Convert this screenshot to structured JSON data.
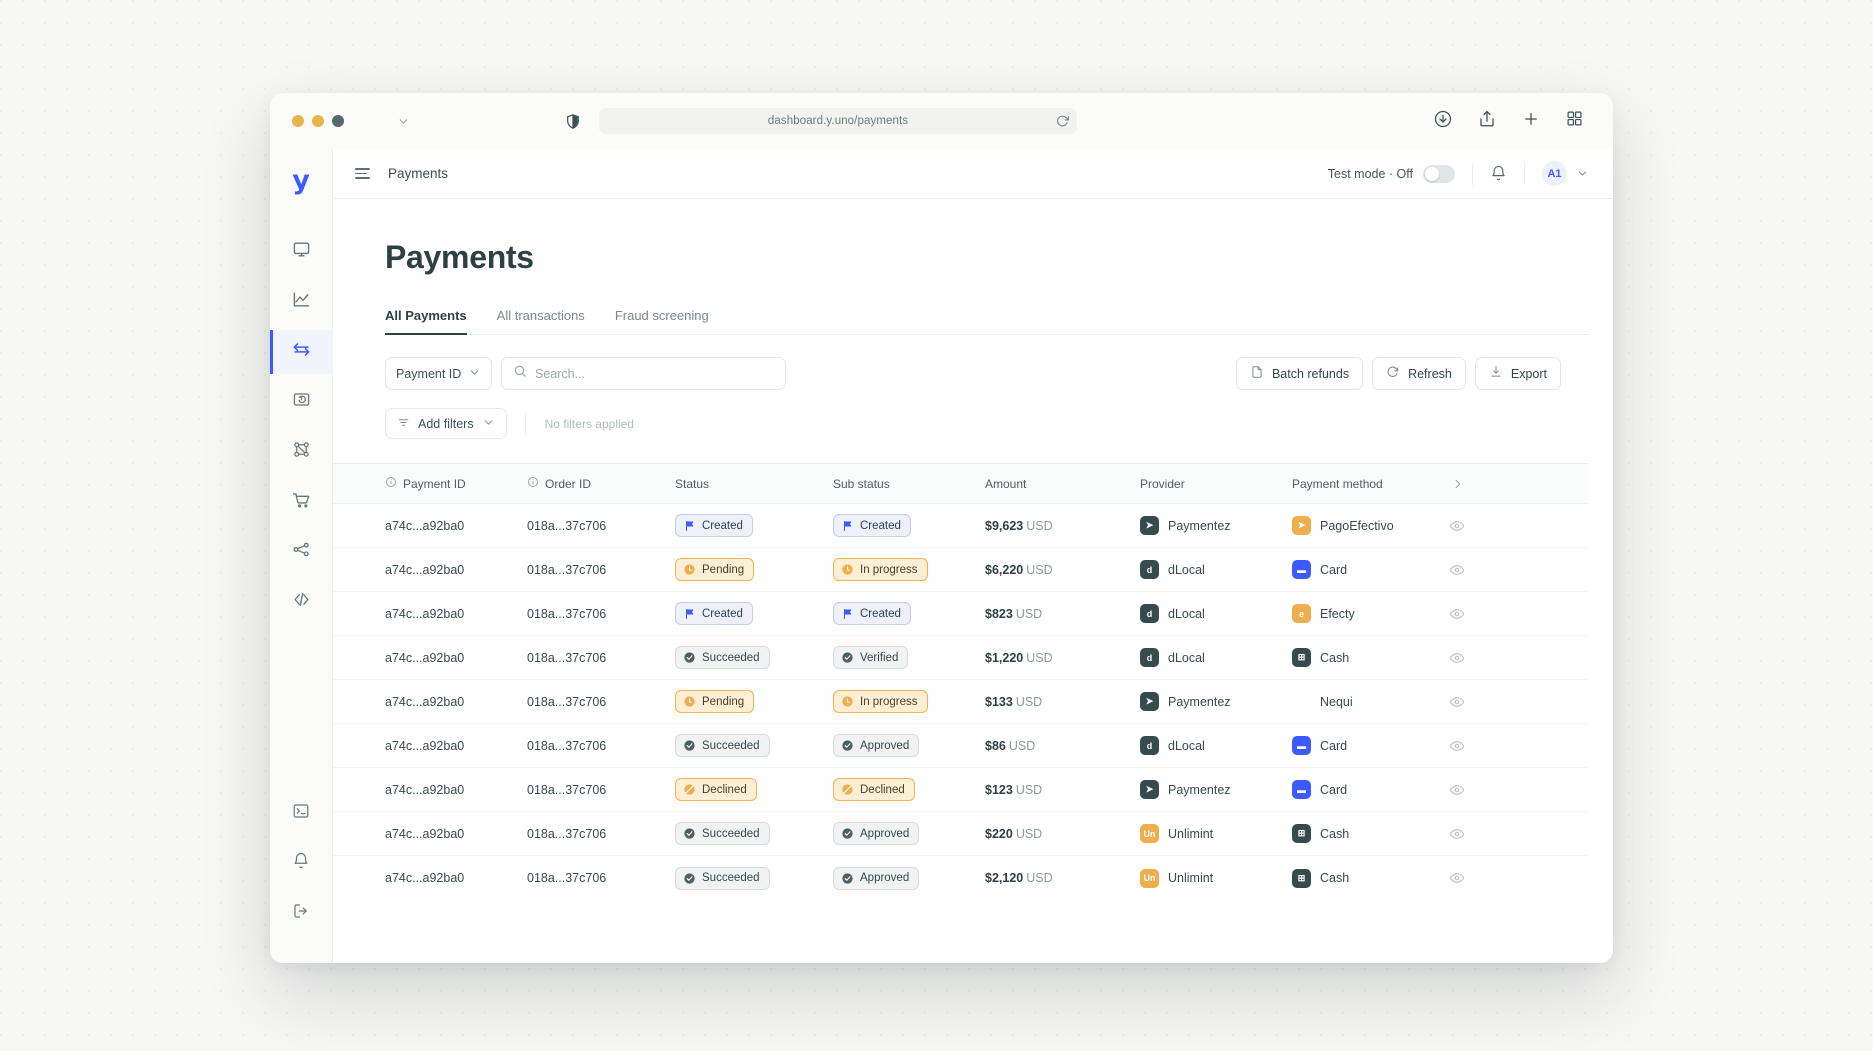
{
  "browser": {
    "url": "dashboard.y.uno/payments",
    "icons": [
      "shield-icon",
      "reload-icon",
      "download-icon",
      "share-icon",
      "new-tab-icon",
      "tab-overview-icon"
    ]
  },
  "rail": {
    "logo": "y",
    "items": [
      {
        "name": "dashboard",
        "icon": "monitor-icon",
        "active": false
      },
      {
        "name": "analytics",
        "icon": "chart-line-icon",
        "active": false
      },
      {
        "name": "payments",
        "icon": "transfer-arrows-icon",
        "active": true
      },
      {
        "name": "refunds",
        "icon": "refund-icon",
        "active": false
      },
      {
        "name": "routing",
        "icon": "nodes-icon",
        "active": false
      },
      {
        "name": "checkout",
        "icon": "cart-icon",
        "active": false
      },
      {
        "name": "connections",
        "icon": "share-nodes-icon",
        "active": false
      },
      {
        "name": "developers",
        "icon": "code-brackets-icon",
        "active": false
      }
    ],
    "bottom": [
      {
        "name": "console",
        "icon": "terminal-icon"
      },
      {
        "name": "notifications",
        "icon": "bell-icon"
      },
      {
        "name": "logout",
        "icon": "logout-icon"
      }
    ]
  },
  "topbar": {
    "breadcrumb": "Payments",
    "test_mode_label": "Test mode · Off",
    "test_mode_on": false,
    "avatar_initials": "A1"
  },
  "page": {
    "title": "Payments",
    "tabs": [
      {
        "label": "All Payments",
        "active": true
      },
      {
        "label": "All transactions",
        "active": false
      },
      {
        "label": "Fraud screening",
        "active": false
      }
    ]
  },
  "filters": {
    "select_value": "Payment ID",
    "search_placeholder": "Search...",
    "search_value": "",
    "add_filters_label": "Add filters",
    "no_filters_text": "No filters applied",
    "actions": [
      {
        "label": "Batch refunds",
        "icon": "file-icon"
      },
      {
        "label": "Refresh",
        "icon": "refresh-icon"
      },
      {
        "label": "Export",
        "icon": "download-icon"
      }
    ]
  },
  "table": {
    "columns": [
      {
        "label": "Payment ID",
        "info": true
      },
      {
        "label": "Order ID",
        "info": true
      },
      {
        "label": "Status",
        "info": false
      },
      {
        "label": "Sub status",
        "info": false
      },
      {
        "label": "Amount",
        "info": false
      },
      {
        "label": "Provider",
        "info": false
      },
      {
        "label": "Payment method",
        "info": false
      }
    ],
    "rows": [
      {
        "payment_id": "a74c...a92ba0",
        "order_id": "018a...37c706",
        "status": "Created",
        "status_kind": "created",
        "sub_status": "Created",
        "sub_kind": "created",
        "amount": "$9,623",
        "currency": "USD",
        "provider": "Paymentez",
        "provider_mark": "➤",
        "provider_style": "ic-dark",
        "method": "PagoEfectivo",
        "method_mark": "➤",
        "method_style": "ic-orange"
      },
      {
        "payment_id": "a74c...a92ba0",
        "order_id": "018a...37c706",
        "status": "Pending",
        "status_kind": "pending",
        "sub_status": "In progress",
        "sub_kind": "pending",
        "amount": "$6,220",
        "currency": "USD",
        "provider": "dLocal",
        "provider_mark": "d",
        "provider_style": "ic-dark",
        "method": "Card",
        "method_mark": "▬",
        "method_style": "ic-blue"
      },
      {
        "payment_id": "a74c...a92ba0",
        "order_id": "018a...37c706",
        "status": "Created",
        "status_kind": "created",
        "sub_status": "Created",
        "sub_kind": "created",
        "amount": "$823",
        "currency": "USD",
        "provider": "dLocal",
        "provider_mark": "d",
        "provider_style": "ic-dark",
        "method": "Efecty",
        "method_mark": "e",
        "method_style": "ic-orange"
      },
      {
        "payment_id": "a74c...a92ba0",
        "order_id": "018a...37c706",
        "status": "Succeeded",
        "status_kind": "succeeded",
        "sub_status": "Verified",
        "sub_kind": "succeeded",
        "amount": "$1,220",
        "currency": "USD",
        "provider": "dLocal",
        "provider_mark": "d",
        "provider_style": "ic-dark",
        "method": "Cash",
        "method_mark": "⊞",
        "method_style": "ic-dark"
      },
      {
        "payment_id": "a74c...a92ba0",
        "order_id": "018a...37c706",
        "status": "Pending",
        "status_kind": "pending",
        "sub_status": "In progress",
        "sub_kind": "pending",
        "amount": "$133",
        "currency": "USD",
        "provider": "Paymentez",
        "provider_mark": "➤",
        "provider_style": "ic-dark",
        "method": "Nequi",
        "method_mark": "⬢",
        "method_style": "ic-plain"
      },
      {
        "payment_id": "a74c...a92ba0",
        "order_id": "018a...37c706",
        "status": "Succeeded",
        "status_kind": "succeeded",
        "sub_status": "Approved",
        "sub_kind": "succeeded",
        "amount": "$86",
        "currency": "USD",
        "provider": "dLocal",
        "provider_mark": "d",
        "provider_style": "ic-dark",
        "method": "Card",
        "method_mark": "▬",
        "method_style": "ic-blue"
      },
      {
        "payment_id": "a74c...a92ba0",
        "order_id": "018a...37c706",
        "status": "Declined",
        "status_kind": "declined",
        "sub_status": "Declined",
        "sub_kind": "declined",
        "amount": "$123",
        "currency": "USD",
        "provider": "Paymentez",
        "provider_mark": "➤",
        "provider_style": "ic-dark",
        "method": "Card",
        "method_mark": "▬",
        "method_style": "ic-blue"
      },
      {
        "payment_id": "a74c...a92ba0",
        "order_id": "018a...37c706",
        "status": "Succeeded",
        "status_kind": "succeeded",
        "sub_status": "Approved",
        "sub_kind": "succeeded",
        "amount": "$220",
        "currency": "USD",
        "provider": "Unlimint",
        "provider_mark": "Un",
        "provider_style": "ic-orange",
        "method": "Cash",
        "method_mark": "⊞",
        "method_style": "ic-dark"
      },
      {
        "payment_id": "a74c...a92ba0",
        "order_id": "018a...37c706",
        "status": "Succeeded",
        "status_kind": "succeeded",
        "sub_status": "Approved",
        "sub_kind": "succeeded",
        "amount": "$2,120",
        "currency": "USD",
        "provider": "Unlimint",
        "provider_mark": "Un",
        "provider_style": "ic-orange",
        "method": "Cash",
        "method_mark": "⊞",
        "method_style": "ic-dark"
      }
    ]
  },
  "colors": {
    "brand_blue": "#3d5afe",
    "text_dark": "#2d4143",
    "amber": "#efae4e",
    "badge_created_bg": "#eef1fa",
    "badge_pending_bg": "#fdeed6",
    "badge_succeeded_bg": "#f1f3f3"
  }
}
